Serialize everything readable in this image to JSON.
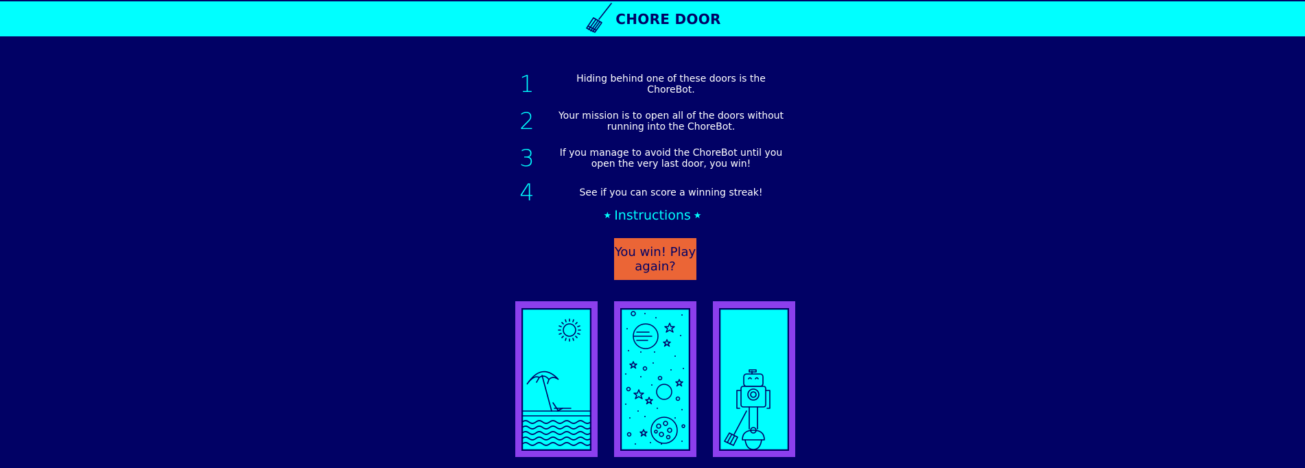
{
  "header": {
    "title": "CHORE DOOR",
    "logo_icon": "broom-icon"
  },
  "instructions": {
    "rows": [
      {
        "number": "1",
        "text": "Hiding behind one of these doors is the ChoreBot."
      },
      {
        "number": "2",
        "text": "Your mission is to open all of the doors without running into the ChoreBot."
      },
      {
        "number": "3",
        "text": "If you manage to avoid the ChoreBot until you open the very last door, you win!"
      },
      {
        "number": "4",
        "text": "See if you can score a winning streak!"
      }
    ],
    "title": "Instructions",
    "star_glyph": "★"
  },
  "game": {
    "status_button": "You win! Play again?"
  },
  "doors": [
    {
      "scene": "beach",
      "icon": "beach-door-icon"
    },
    {
      "scene": "space",
      "icon": "space-door-icon"
    },
    {
      "scene": "chorebot",
      "icon": "chorebot-door-icon"
    }
  ],
  "colors": {
    "background": "#010165",
    "accent": "#00ffff",
    "door_frame": "#8c3fed",
    "button": "#eb6536"
  }
}
